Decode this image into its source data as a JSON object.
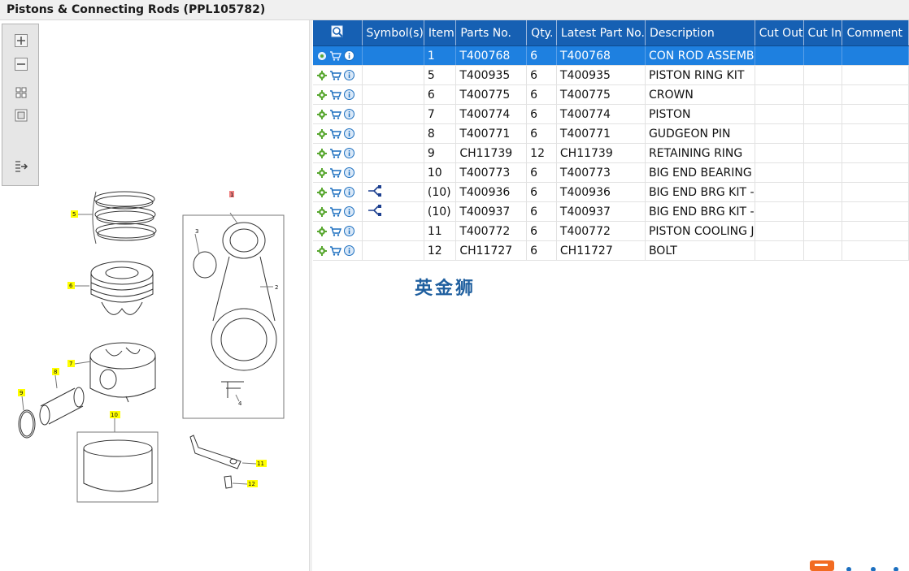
{
  "window": {
    "title": "Pistons & Connecting Rods (PPL105782)"
  },
  "toolbar": {
    "buttons": [
      {
        "name": "zoom-in-icon"
      },
      {
        "name": "zoom-out-icon"
      },
      {
        "name": "fit-page-icon"
      },
      {
        "name": "actual-size-icon"
      },
      {
        "name": "export-icon"
      }
    ]
  },
  "diagram": {
    "callouts": [
      "1",
      "2",
      "3",
      "4",
      "5",
      "6",
      "7",
      "8",
      "9",
      "10",
      "11",
      "12"
    ]
  },
  "grid": {
    "columns": [
      "Symbol(s)",
      "Item",
      "Parts No.",
      "Qty.",
      "Latest Part No.",
      "Description",
      "Cut Out",
      "Cut In",
      "Comment"
    ],
    "rows": [
      {
        "item": "1",
        "part": "T400768",
        "qty": "6",
        "latest": "T400768",
        "desc": "CON ROD ASSEMB",
        "symbol": "",
        "selected": true
      },
      {
        "item": "5",
        "part": "T400935",
        "qty": "6",
        "latest": "T400935",
        "desc": "PISTON RING KIT",
        "symbol": ""
      },
      {
        "item": "6",
        "part": "T400775",
        "qty": "6",
        "latest": "T400775",
        "desc": "CROWN",
        "symbol": ""
      },
      {
        "item": "7",
        "part": "T400774",
        "qty": "6",
        "latest": "T400774",
        "desc": "PISTON",
        "symbol": ""
      },
      {
        "item": "8",
        "part": "T400771",
        "qty": "6",
        "latest": "T400771",
        "desc": "GUDGEON PIN",
        "symbol": ""
      },
      {
        "item": "9",
        "part": "CH11739",
        "qty": "12",
        "latest": "CH11739",
        "desc": "RETAINING RING",
        "symbol": ""
      },
      {
        "item": "10",
        "part": "T400773",
        "qty": "6",
        "latest": "T400773",
        "desc": "BIG END BEARING",
        "symbol": ""
      },
      {
        "item": "(10)",
        "part": "T400936",
        "qty": "6",
        "latest": "T400936",
        "desc": "BIG END BRG KIT -",
        "symbol": "alternative-icon"
      },
      {
        "item": "(10)",
        "part": "T400937",
        "qty": "6",
        "latest": "T400937",
        "desc": "BIG END BRG KIT -",
        "symbol": "alternative-icon"
      },
      {
        "item": "11",
        "part": "T400772",
        "qty": "6",
        "latest": "T400772",
        "desc": "PISTON COOLING J",
        "symbol": ""
      },
      {
        "item": "12",
        "part": "CH11727",
        "qty": "6",
        "latest": "CH11727",
        "desc": "BOLT",
        "symbol": ""
      }
    ]
  },
  "watermark": "英金狮",
  "colors": {
    "header": "#1660b3",
    "selected_row": "#1e80e0",
    "callout": "#ffff00"
  }
}
